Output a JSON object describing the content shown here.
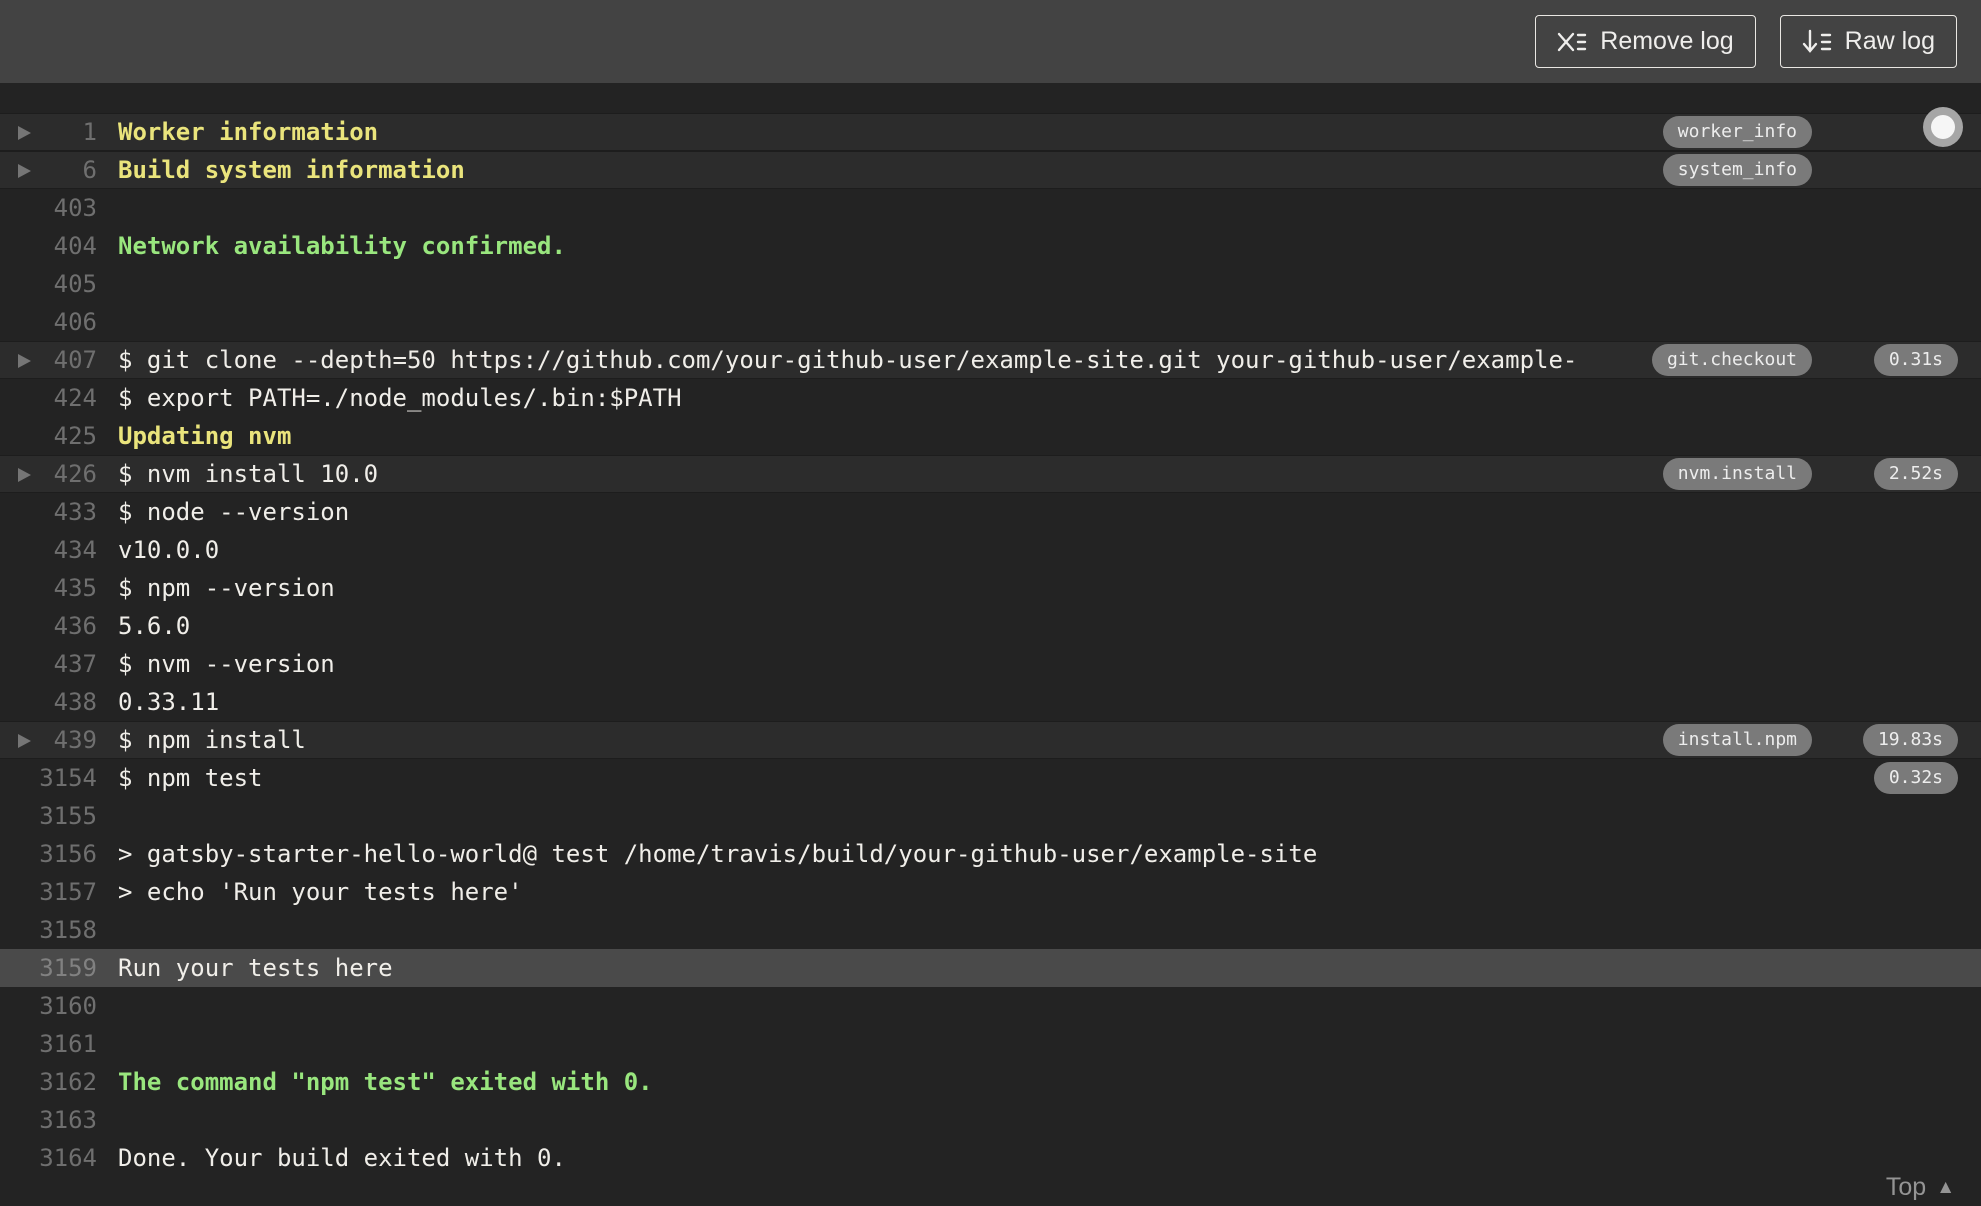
{
  "toolbar": {
    "remove_log_label": "Remove log",
    "raw_log_label": "Raw log"
  },
  "footer": {
    "top_label": "Top",
    "top_icon_glyph": "▲"
  },
  "colors": {
    "header_bg": "#434343",
    "log_bg": "#232323",
    "section_row_bg": "#2c2c2c",
    "highlight_row_bg": "#4a4a4a",
    "fold_title_yellow": "#eae47c",
    "success_green": "#99e67e",
    "text_white": "#f0eee9",
    "line_number_gray": "#6f6f6f",
    "badge_bg": "#7a7a7a"
  },
  "log": {
    "rows": [
      {
        "num": "1",
        "text": "Worker information",
        "style": "fold-title",
        "fold": true,
        "section": true,
        "tag": "worker_info"
      },
      {
        "num": "6",
        "text": "Build system information",
        "style": "fold-title",
        "fold": true,
        "section": true,
        "tag": "system_info"
      },
      {
        "num": "403",
        "text": ""
      },
      {
        "num": "404",
        "text": "Network availability confirmed.",
        "style": "success"
      },
      {
        "num": "405",
        "text": ""
      },
      {
        "num": "406",
        "text": ""
      },
      {
        "num": "407",
        "text": "$ git clone --depth=50 https://github.com/your-github-user/example-site.git your-github-user/example-",
        "fold": true,
        "section": true,
        "tag": "git.checkout",
        "duration": "0.31s"
      },
      {
        "num": "424",
        "text": "$ export PATH=./node_modules/.bin:$PATH"
      },
      {
        "num": "425",
        "text": "Updating nvm",
        "style": "fold-title"
      },
      {
        "num": "426",
        "text": "$ nvm install 10.0",
        "fold": true,
        "section": true,
        "tag": "nvm.install",
        "duration": "2.52s"
      },
      {
        "num": "433",
        "text": "$ node --version"
      },
      {
        "num": "434",
        "text": "v10.0.0"
      },
      {
        "num": "435",
        "text": "$ npm --version"
      },
      {
        "num": "436",
        "text": "5.6.0"
      },
      {
        "num": "437",
        "text": "$ nvm --version"
      },
      {
        "num": "438",
        "text": "0.33.11"
      },
      {
        "num": "439",
        "text": "$ npm install",
        "fold": true,
        "section": true,
        "tag": "install.npm",
        "duration": "19.83s"
      },
      {
        "num": "3154",
        "text": "$ npm test",
        "duration": "0.32s"
      },
      {
        "num": "3155",
        "text": ""
      },
      {
        "num": "3156",
        "text": "> gatsby-starter-hello-world@ test /home/travis/build/your-github-user/example-site"
      },
      {
        "num": "3157",
        "text": "> echo 'Run your tests here'"
      },
      {
        "num": "3158",
        "text": ""
      },
      {
        "num": "3159",
        "text": "Run your tests here",
        "highlight": true
      },
      {
        "num": "3160",
        "text": ""
      },
      {
        "num": "3161",
        "text": ""
      },
      {
        "num": "3162",
        "text": "The command \"npm test\" exited with 0.",
        "style": "success"
      },
      {
        "num": "3163",
        "text": ""
      },
      {
        "num": "3164",
        "text": "Done. Your build exited with 0."
      }
    ]
  }
}
